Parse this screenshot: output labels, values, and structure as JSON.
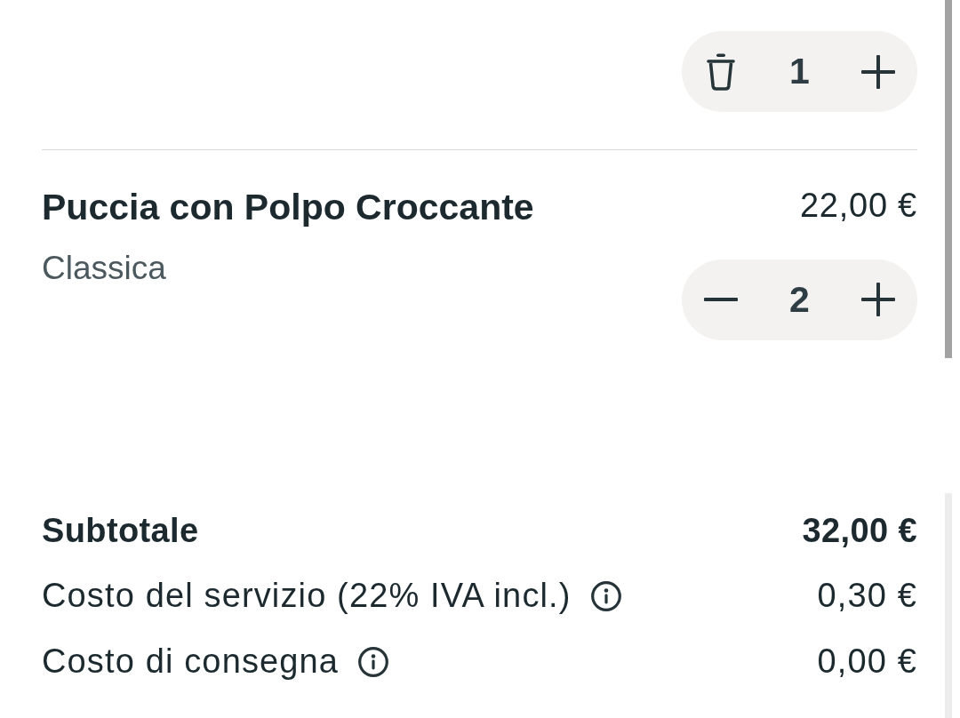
{
  "basket_items": [
    {
      "kind": "delete",
      "quantity": "1"
    },
    {
      "kind": "decrease",
      "name": "Puccia con Polpo Croccante",
      "price": "22,00 €",
      "option": "Classica",
      "quantity": "2"
    }
  ],
  "summary": [
    {
      "kind": "subtotal",
      "label": "Subtotale",
      "value": "32,00 €",
      "info": false
    },
    {
      "kind": "fee",
      "label": "Costo del servizio (22% IVA incl.)",
      "value": "0,30 €",
      "info": true
    },
    {
      "kind": "fee",
      "label": "Costo di consegna",
      "value": "0,00 €",
      "info": true
    }
  ]
}
